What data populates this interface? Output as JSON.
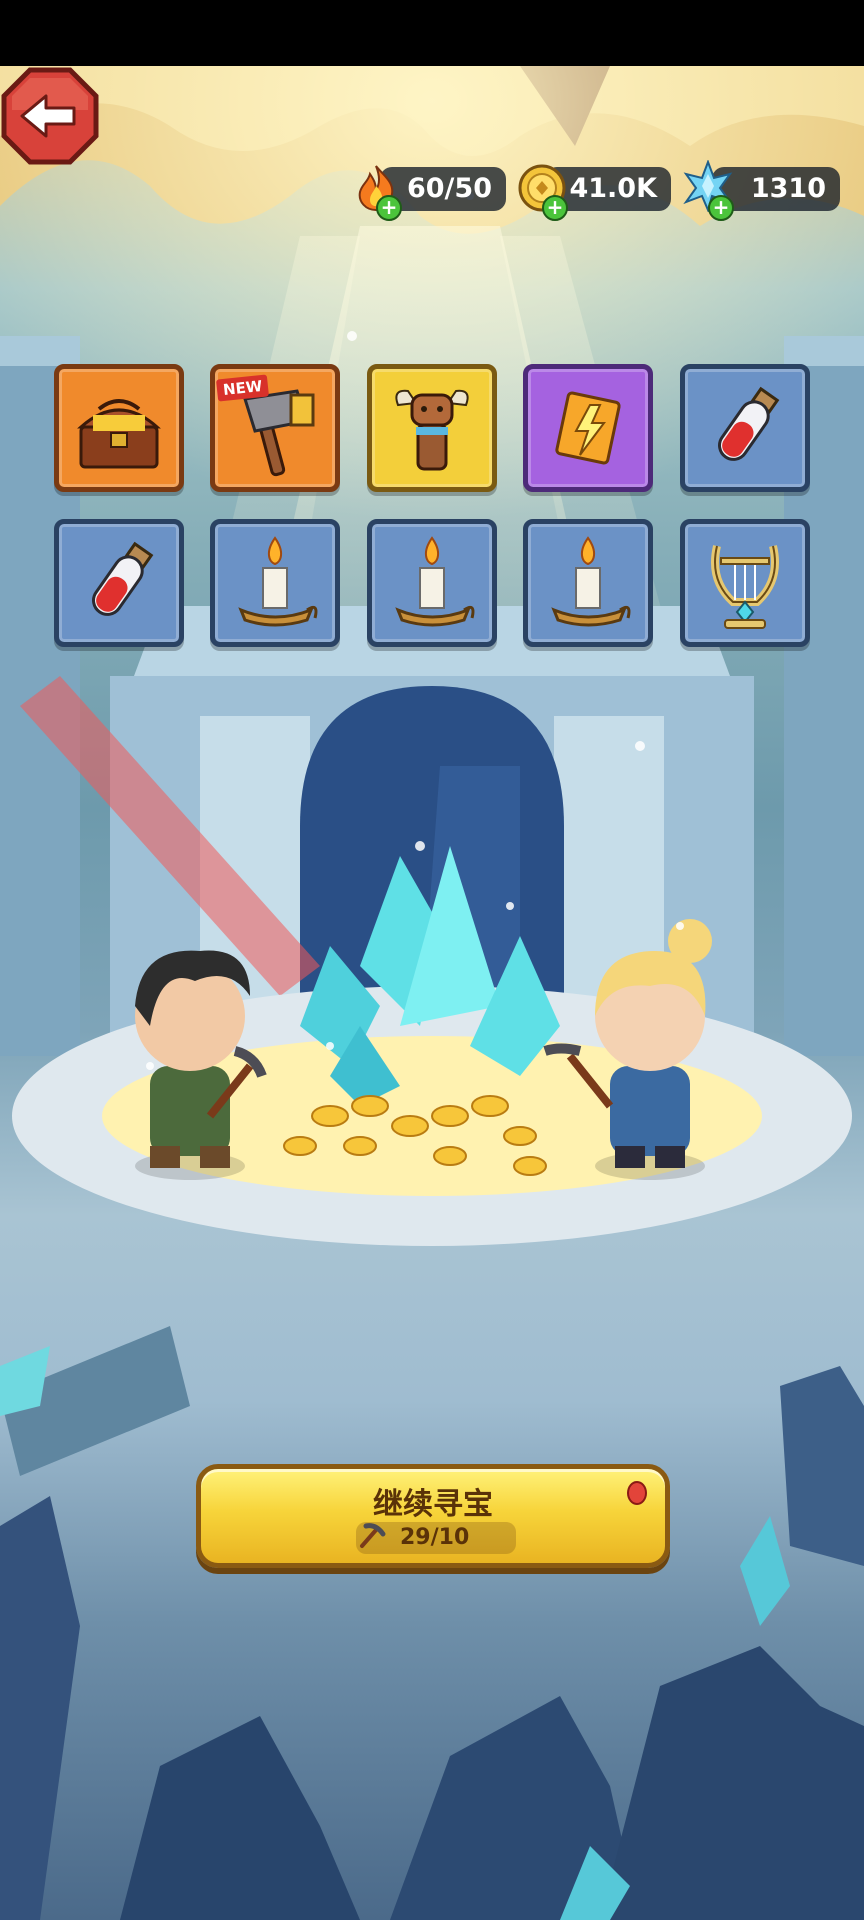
{
  "resources": {
    "energy": {
      "value": "60/50",
      "icon": "flame-icon"
    },
    "gold": {
      "value": "41.0K",
      "icon": "gold-coin-icon"
    },
    "crystal": {
      "value": "1310",
      "icon": "crystal-icon"
    }
  },
  "items": [
    {
      "name": "treasure-chest-icon",
      "rarity": "orange"
    },
    {
      "name": "hammer-icon",
      "rarity": "orange",
      "badge": "NEW"
    },
    {
      "name": "bull-totem-icon",
      "rarity": "gold"
    },
    {
      "name": "lightning-scroll-icon",
      "rarity": "purple"
    },
    {
      "name": "red-potion-icon",
      "rarity": "blue"
    },
    {
      "name": "red-potion-icon",
      "rarity": "blue"
    },
    {
      "name": "candle-icon",
      "rarity": "blue"
    },
    {
      "name": "candle-icon",
      "rarity": "blue"
    },
    {
      "name": "candle-icon",
      "rarity": "blue"
    },
    {
      "name": "lyre-icon",
      "rarity": "blue"
    }
  ],
  "continue": {
    "label": "继续寻宝",
    "count": "29/10",
    "icon": "pickaxe-icon"
  },
  "back": {
    "icon": "back-arrow-icon"
  },
  "colors": {
    "orange_tile": "#f08a2c",
    "gold_tile": "#f3cf3a",
    "purple_tile": "#a562e0",
    "blue_tile": "#6b92c6",
    "button_yellow": "#f7d43a",
    "back_red": "#d8423a"
  }
}
